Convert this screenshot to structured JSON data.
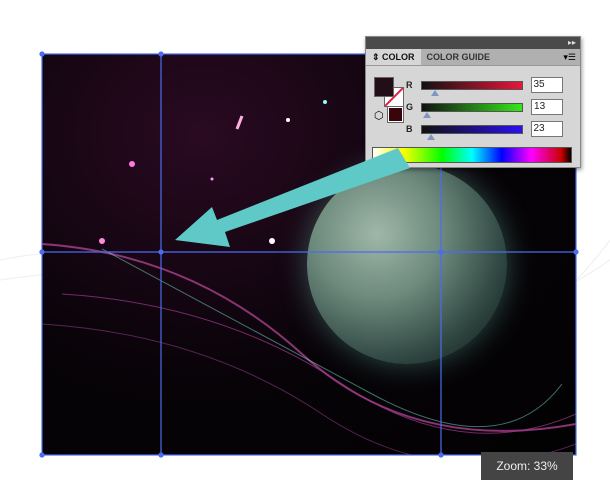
{
  "panel": {
    "tabs": [
      "COLOR",
      "COLOR GUIDE"
    ],
    "channels": [
      {
        "label": "R",
        "value": "35",
        "fraction": 0.137,
        "color": "#e8163a"
      },
      {
        "label": "G",
        "value": "13",
        "fraction": 0.051,
        "color": "#35e81a"
      },
      {
        "label": "B",
        "value": "23",
        "fraction": 0.09,
        "color": "#2a10f0"
      }
    ],
    "fill_color": "#230d17",
    "stroke_color": "#3a0508"
  },
  "status": {
    "zoom": "Zoom: 33%"
  },
  "colors": {
    "arrow": "#5ec9c6",
    "guide": "#4a6cf0"
  }
}
